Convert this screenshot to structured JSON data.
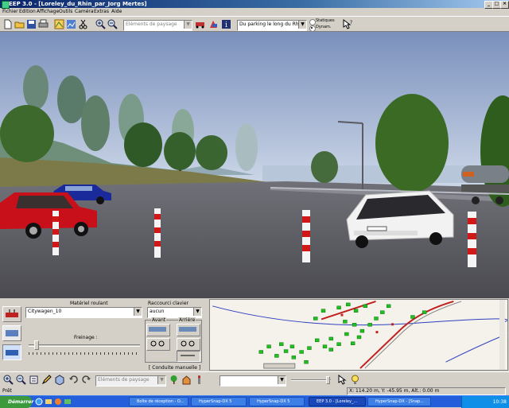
{
  "window": {
    "title": "EEP 3.0 - [Loreley_du_Rhin_par_Jorg Mertes]"
  },
  "menu": [
    "Fichier",
    "Edition",
    "Affichage",
    "Outils",
    "Caméra",
    "Extras",
    "Aide"
  ],
  "toolbar": {
    "layer_combo": "Eléments de paysage",
    "camera_combo": "Du parking le long du Rhin",
    "radio_static": "Statiques",
    "radio_dynamic": "Dynam."
  },
  "panel": {
    "rolling_stock_label": "Matériel roulant",
    "rolling_stock_value": "Citywagen_10",
    "braking_label": "Freinage :",
    "braking_level": 0.05,
    "shortcut_label": "Raccourci clavier",
    "shortcut_value": "aucun",
    "forward_label": "Avant",
    "backward_label": "Arrière",
    "manual_driving": "[ Conduite manuelle ]"
  },
  "bottom_toolbar": {
    "layer_combo": "Eléments de paysage"
  },
  "statusbar": {
    "left": "Prêt",
    "coords": "X: 114.20 m, Y: -45.95 m, Alt.: 0.00 m"
  },
  "taskbar": {
    "start": "Démarrer",
    "tasks": [
      "Boîte de réception - O...",
      "HyperSnap-DX 5",
      "HyperSnap-DX 5",
      "EEP 3.0 - [Loreley_...",
      "HyperSnap-DX - [Snap..."
    ],
    "clock": "10:38"
  }
}
